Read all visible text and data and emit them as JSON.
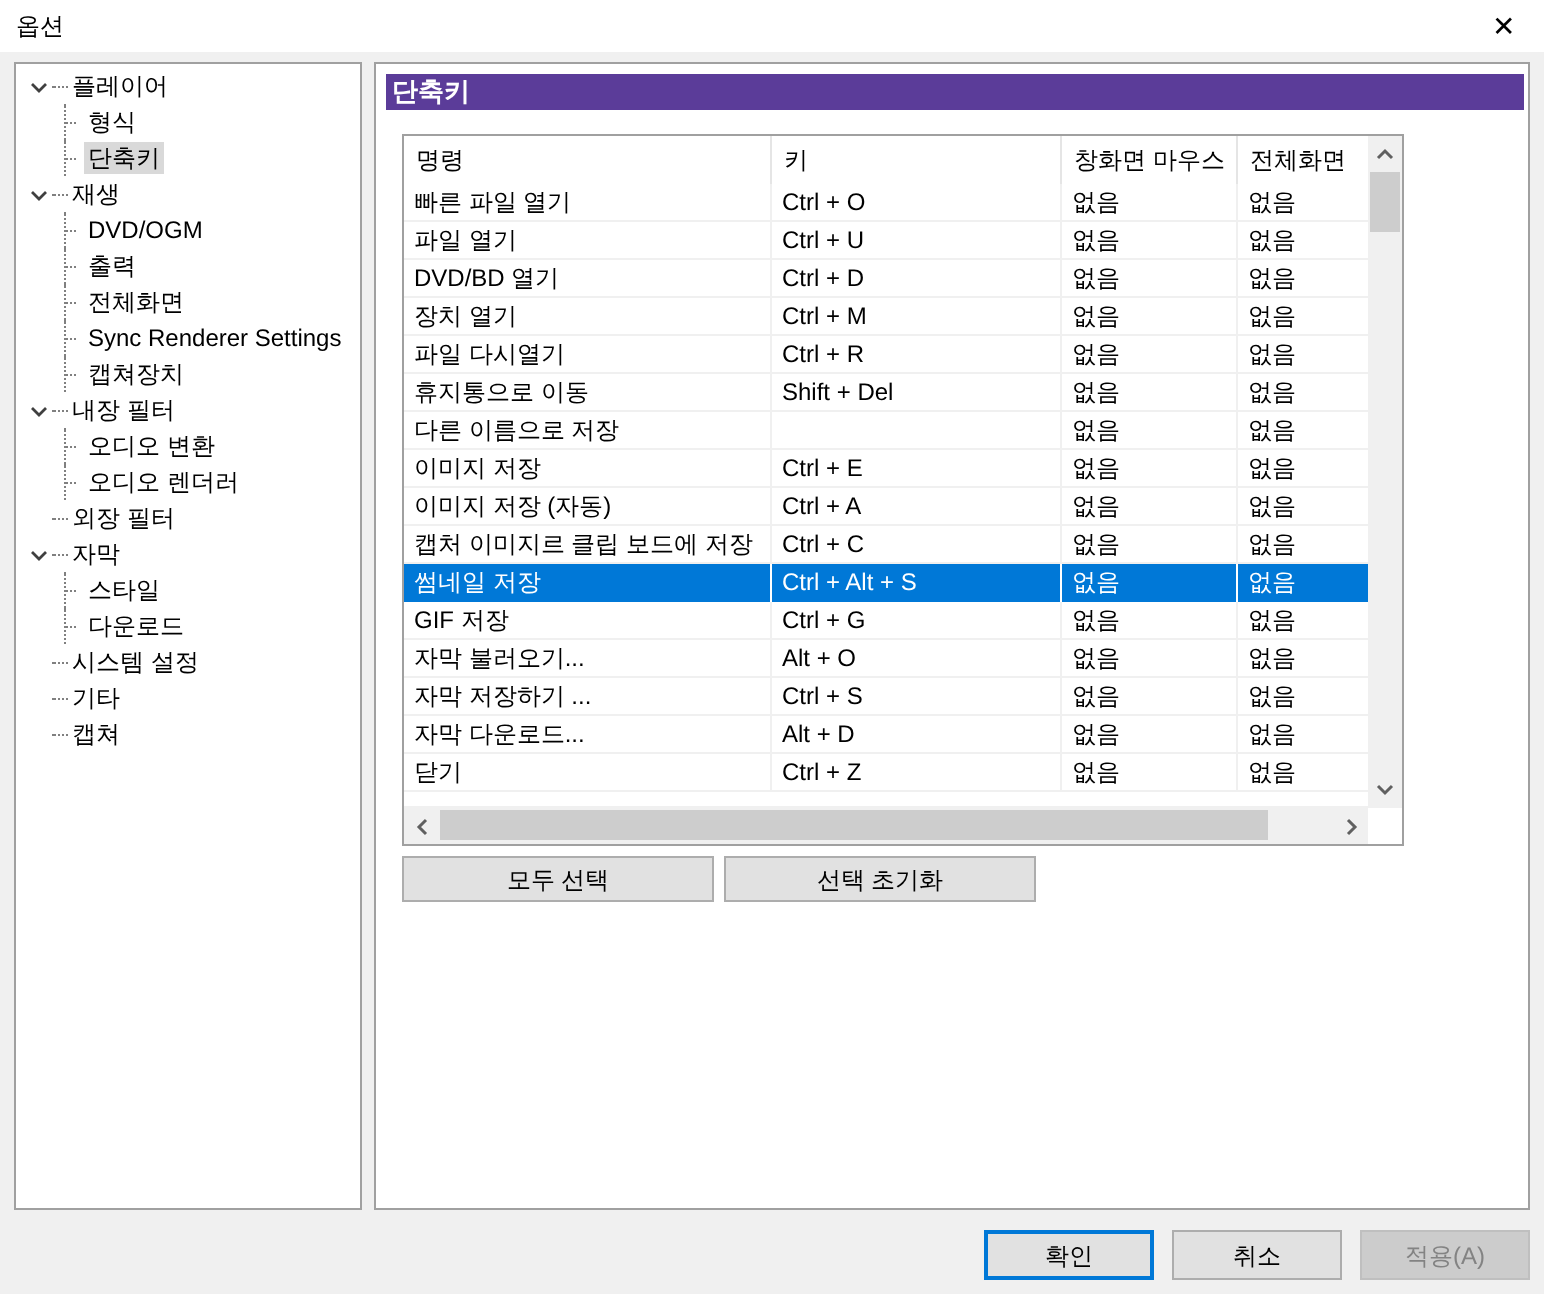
{
  "window": {
    "title": "옵션",
    "close": "✕"
  },
  "tree": [
    {
      "label": "플레이어",
      "expanded": true,
      "selected": false,
      "children": [
        {
          "label": "형식",
          "selected": false
        },
        {
          "label": "단축키",
          "selected": true
        }
      ]
    },
    {
      "label": "재생",
      "expanded": true,
      "selected": false,
      "children": [
        {
          "label": "DVD/OGM",
          "selected": false
        },
        {
          "label": "출력",
          "selected": false
        },
        {
          "label": "전체화면",
          "selected": false
        },
        {
          "label": "Sync Renderer Settings",
          "selected": false
        },
        {
          "label": "캡쳐장치",
          "selected": false
        }
      ]
    },
    {
      "label": "내장 필터",
      "expanded": true,
      "selected": false,
      "children": [
        {
          "label": "오디오 변환",
          "selected": false
        },
        {
          "label": "오디오 렌더러",
          "selected": false
        }
      ]
    },
    {
      "label": "외장 필터",
      "selected": false
    },
    {
      "label": "자막",
      "expanded": true,
      "selected": false,
      "children": [
        {
          "label": "스타일",
          "selected": false
        },
        {
          "label": "다운로드",
          "selected": false
        }
      ]
    },
    {
      "label": "시스템 설정",
      "selected": false
    },
    {
      "label": "기타",
      "selected": false
    },
    {
      "label": "캡쳐",
      "selected": false
    }
  ],
  "section": {
    "title": "단축키"
  },
  "table": {
    "columns": [
      "명령",
      "키",
      "창화면 마우스",
      "전체화면"
    ],
    "rows": [
      {
        "cells": [
          "빠른 파일 열기",
          "Ctrl + O",
          "없음",
          "없음"
        ],
        "selected": false
      },
      {
        "cells": [
          "파일 열기",
          "Ctrl + U",
          "없음",
          "없음"
        ],
        "selected": false
      },
      {
        "cells": [
          "DVD/BD 열기",
          "Ctrl + D",
          "없음",
          "없음"
        ],
        "selected": false
      },
      {
        "cells": [
          "장치 열기",
          "Ctrl + M",
          "없음",
          "없음"
        ],
        "selected": false
      },
      {
        "cells": [
          "파일 다시열기",
          "Ctrl + R",
          "없음",
          "없음"
        ],
        "selected": false
      },
      {
        "cells": [
          "휴지통으로 이동",
          "Shift + Del",
          "없음",
          "없음"
        ],
        "selected": false
      },
      {
        "cells": [
          "다른 이름으로 저장",
          "",
          "없음",
          "없음"
        ],
        "selected": false
      },
      {
        "cells": [
          "이미지 저장",
          "Ctrl + E",
          "없음",
          "없음"
        ],
        "selected": false
      },
      {
        "cells": [
          "이미지 저장 (자동)",
          "Ctrl + A",
          "없음",
          "없음"
        ],
        "selected": false
      },
      {
        "cells": [
          "캡처 이미지르 클립 보드에 저장",
          "Ctrl + C",
          "없음",
          "없음"
        ],
        "selected": false
      },
      {
        "cells": [
          "썸네일 저장",
          "Ctrl + Alt + S",
          "없음",
          "없음"
        ],
        "selected": true
      },
      {
        "cells": [
          "GIF 저장",
          "Ctrl + G",
          "없음",
          "없음"
        ],
        "selected": false
      },
      {
        "cells": [
          "자막 불러오기...",
          "Alt + O",
          "없음",
          "없음"
        ],
        "selected": false
      },
      {
        "cells": [
          "자막 저장하기 ...",
          "Ctrl + S",
          "없음",
          "없음"
        ],
        "selected": false
      },
      {
        "cells": [
          "자막 다운로드...",
          "Alt + D",
          "없음",
          "없음"
        ],
        "selected": false
      },
      {
        "cells": [
          "닫기",
          "Ctrl + Z",
          "없음",
          "없음"
        ],
        "selected": false
      }
    ]
  },
  "table_buttons": [
    "모두 선택",
    "선택 초기화"
  ],
  "dialog_buttons": [
    {
      "label": "확인",
      "kind": "default",
      "disabled": false
    },
    {
      "label": "취소",
      "kind": "normal",
      "disabled": false
    },
    {
      "label": "적용(A)",
      "kind": "normal",
      "disabled": true
    }
  ]
}
